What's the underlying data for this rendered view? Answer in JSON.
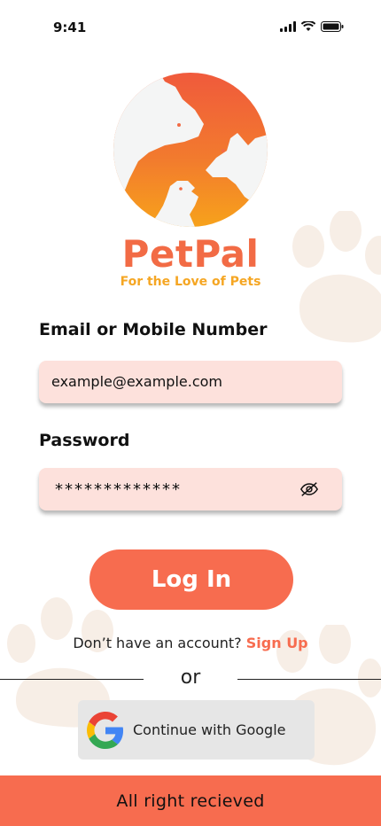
{
  "status_bar": {
    "time": "9:41"
  },
  "brand": {
    "name": "PetPal",
    "tagline": "For the Love of Pets"
  },
  "form": {
    "email_label": "Email or Mobile Number",
    "email_value": "example@example.com",
    "password_label": "Password",
    "password_value": "*************"
  },
  "actions": {
    "login_label": "Log In",
    "signup_prompt": "Don’t have an account?",
    "signup_link": "Sign Up",
    "or_text": "or",
    "google_label": "Continue with Google"
  },
  "footer": {
    "text": "All right  recieved"
  },
  "colors": {
    "accent": "#F76C4F",
    "brand_orange": "#F26B45",
    "tagline_yellow": "#F5A623",
    "input_bg": "#FDE1DC",
    "google_bg": "#E6E6E6"
  },
  "icons": [
    "signal-icon",
    "wifi-icon",
    "battery-icon",
    "eye-off-icon",
    "google-logo-icon",
    "paw-print-icon"
  ]
}
